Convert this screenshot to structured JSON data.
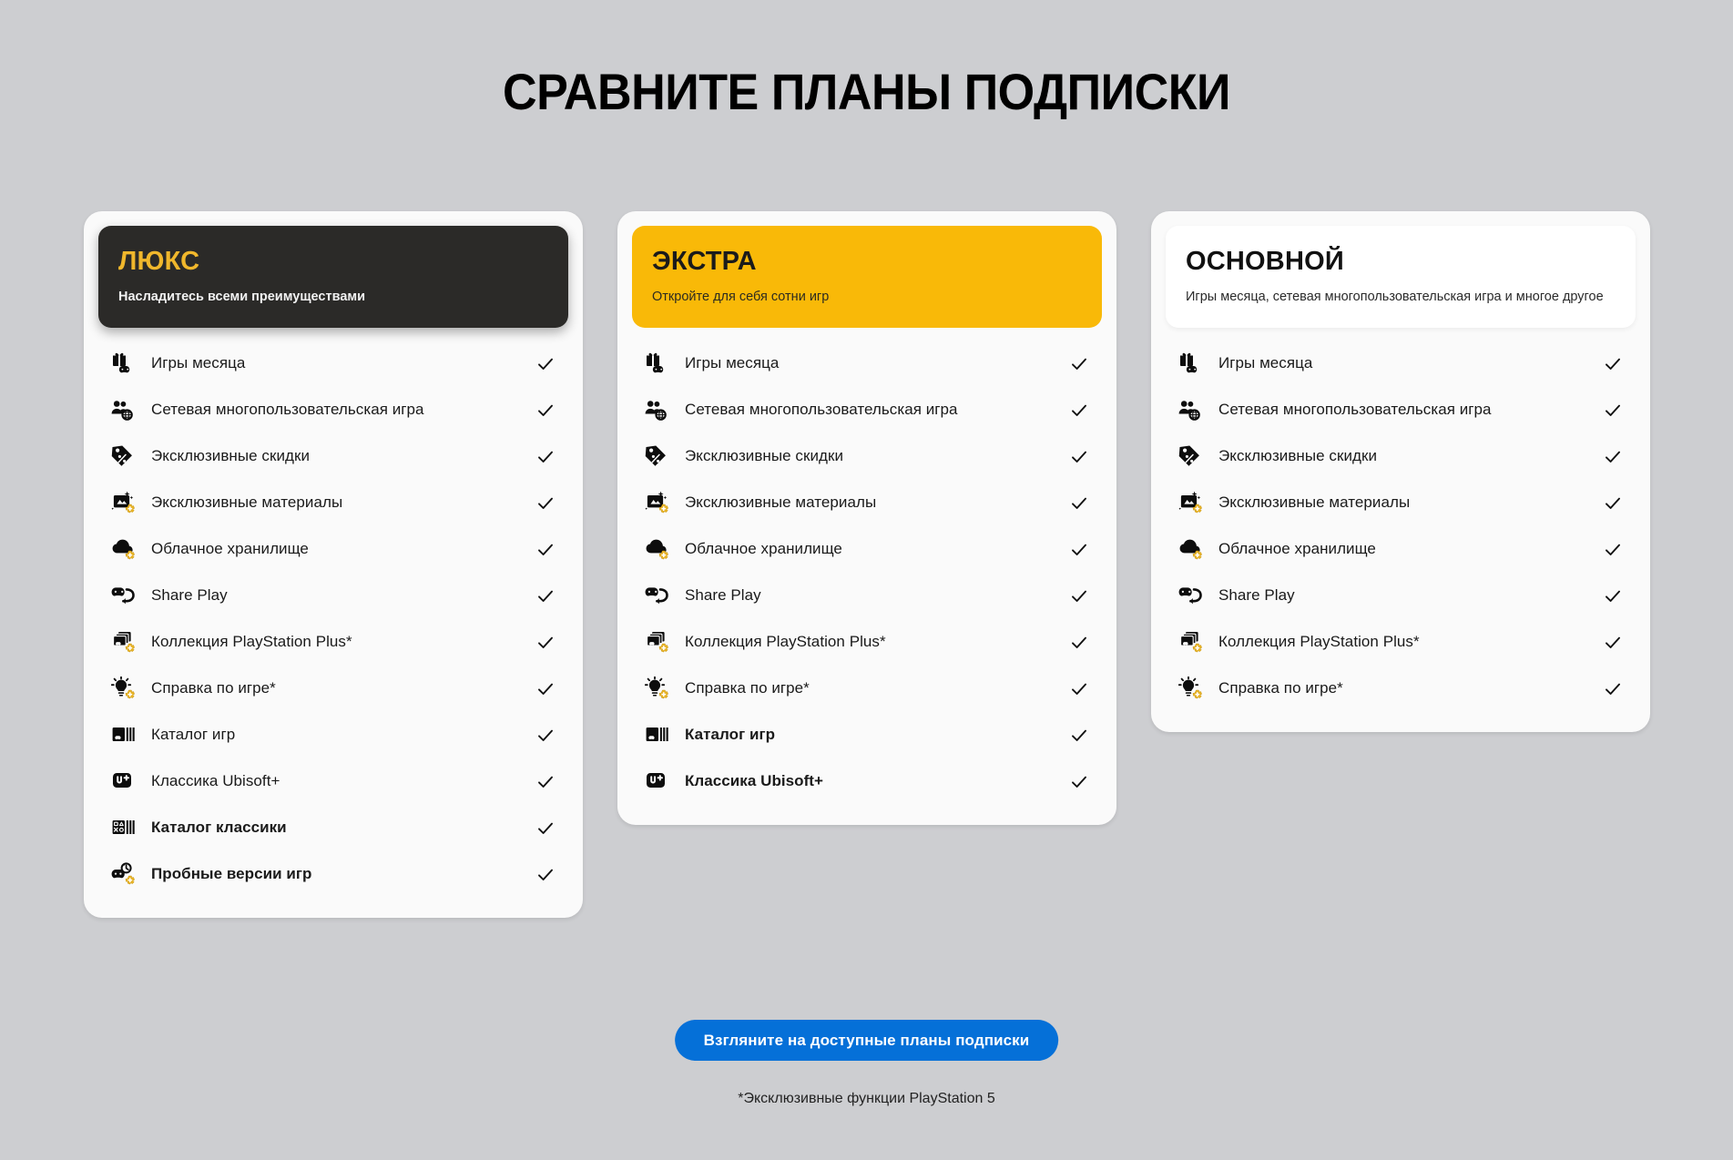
{
  "page": {
    "title": "СРАВНИТЕ ПЛАНЫ ПОДПИСКИ",
    "background_color": "#cdced1",
    "cta_label": "Взгляните на доступные планы подписки",
    "cta_color": "#0570d8",
    "footnote": "*Эксклюзивные функции PlayStation 5"
  },
  "plans": [
    {
      "name": "ЛЮКС",
      "tagline": "Насладитесь всеми преимуществами",
      "header_bg": "#2b2a28",
      "header_text_color": "#f0b72c",
      "features": [
        {
          "label": "Игры месяца",
          "icon": "gift-controller-icon",
          "bold": false,
          "included": true,
          "check": "✓"
        },
        {
          "label": "Сетевая многопользовательская игра",
          "icon": "people-globe-icon",
          "bold": false,
          "included": true,
          "check": "✓"
        },
        {
          "label": "Эксклюзивные скидки",
          "icon": "price-tag-icon",
          "bold": false,
          "included": true,
          "check": "✓"
        },
        {
          "label": "Эксклюзивные материалы",
          "icon": "sparkle-card-plus-icon",
          "bold": false,
          "included": true,
          "check": "✓"
        },
        {
          "label": "Облачное хранилище",
          "icon": "cloud-plus-icon",
          "bold": false,
          "included": true,
          "check": "✓"
        },
        {
          "label": "Share Play",
          "icon": "share-play-icon",
          "bold": false,
          "included": true,
          "check": "✓"
        },
        {
          "label": "Коллекция PlayStation Plus*",
          "icon": "game-stack-plus-icon",
          "bold": false,
          "included": true,
          "check": "✓"
        },
        {
          "label": "Справка по игре*",
          "icon": "lightbulb-plus-icon",
          "bold": false,
          "included": true,
          "check": "✓"
        },
        {
          "label": "Каталог игр",
          "icon": "game-catalog-icon",
          "bold": false,
          "included": true,
          "check": "✓"
        },
        {
          "label": "Классика Ubisoft+",
          "icon": "ubisoft-plus-icon",
          "bold": false,
          "included": true,
          "check": "✓"
        },
        {
          "label": "Каталог классики",
          "icon": "classics-catalog-icon",
          "bold": true,
          "included": true,
          "check": "✓"
        },
        {
          "label": "Пробные версии игр",
          "icon": "game-trial-plus-icon",
          "bold": true,
          "included": true,
          "check": "✓"
        }
      ]
    },
    {
      "name": "ЭКСТРА",
      "tagline": "Откройте для себя сотни игр",
      "header_bg": "#f9b908",
      "header_text_color": "#1b1b1b",
      "features": [
        {
          "label": "Игры месяца",
          "icon": "gift-controller-icon",
          "bold": false,
          "included": true,
          "check": "✓"
        },
        {
          "label": "Сетевая многопользовательская игра",
          "icon": "people-globe-icon",
          "bold": false,
          "included": true,
          "check": "✓"
        },
        {
          "label": "Эксклюзивные скидки",
          "icon": "price-tag-icon",
          "bold": false,
          "included": true,
          "check": "✓"
        },
        {
          "label": "Эксклюзивные материалы",
          "icon": "sparkle-card-plus-icon",
          "bold": false,
          "included": true,
          "check": "✓"
        },
        {
          "label": "Облачное хранилище",
          "icon": "cloud-plus-icon",
          "bold": false,
          "included": true,
          "check": "✓"
        },
        {
          "label": "Share Play",
          "icon": "share-play-icon",
          "bold": false,
          "included": true,
          "check": "✓"
        },
        {
          "label": "Коллекция PlayStation Plus*",
          "icon": "game-stack-plus-icon",
          "bold": false,
          "included": true,
          "check": "✓"
        },
        {
          "label": "Справка по игре*",
          "icon": "lightbulb-plus-icon",
          "bold": false,
          "included": true,
          "check": "✓"
        },
        {
          "label": "Каталог игр",
          "icon": "game-catalog-icon",
          "bold": true,
          "included": true,
          "check": "✓"
        },
        {
          "label": "Классика Ubisoft+",
          "icon": "ubisoft-plus-icon",
          "bold": true,
          "included": true,
          "check": "✓"
        }
      ]
    },
    {
      "name": "ОСНОВНОЙ",
      "tagline": "Игры месяца, сетевая многопользовательская игра и многое другое",
      "header_bg": "#ffffff",
      "header_text_color": "#111111",
      "features": [
        {
          "label": "Игры месяца",
          "icon": "gift-controller-icon",
          "bold": false,
          "included": true,
          "check": "✓"
        },
        {
          "label": "Сетевая многопользовательская игра",
          "icon": "people-globe-icon",
          "bold": false,
          "included": true,
          "check": "✓"
        },
        {
          "label": "Эксклюзивные скидки",
          "icon": "price-tag-icon",
          "bold": false,
          "included": true,
          "check": "✓"
        },
        {
          "label": "Эксклюзивные материалы",
          "icon": "sparkle-card-plus-icon",
          "bold": false,
          "included": true,
          "check": "✓"
        },
        {
          "label": "Облачное хранилище",
          "icon": "cloud-plus-icon",
          "bold": false,
          "included": true,
          "check": "✓"
        },
        {
          "label": "Share Play",
          "icon": "share-play-icon",
          "bold": false,
          "included": true,
          "check": "✓"
        },
        {
          "label": "Коллекция PlayStation Plus*",
          "icon": "game-stack-plus-icon",
          "bold": false,
          "included": true,
          "check": "✓"
        },
        {
          "label": "Справка по игре*",
          "icon": "lightbulb-plus-icon",
          "bold": false,
          "included": true,
          "check": "✓"
        }
      ]
    }
  ]
}
